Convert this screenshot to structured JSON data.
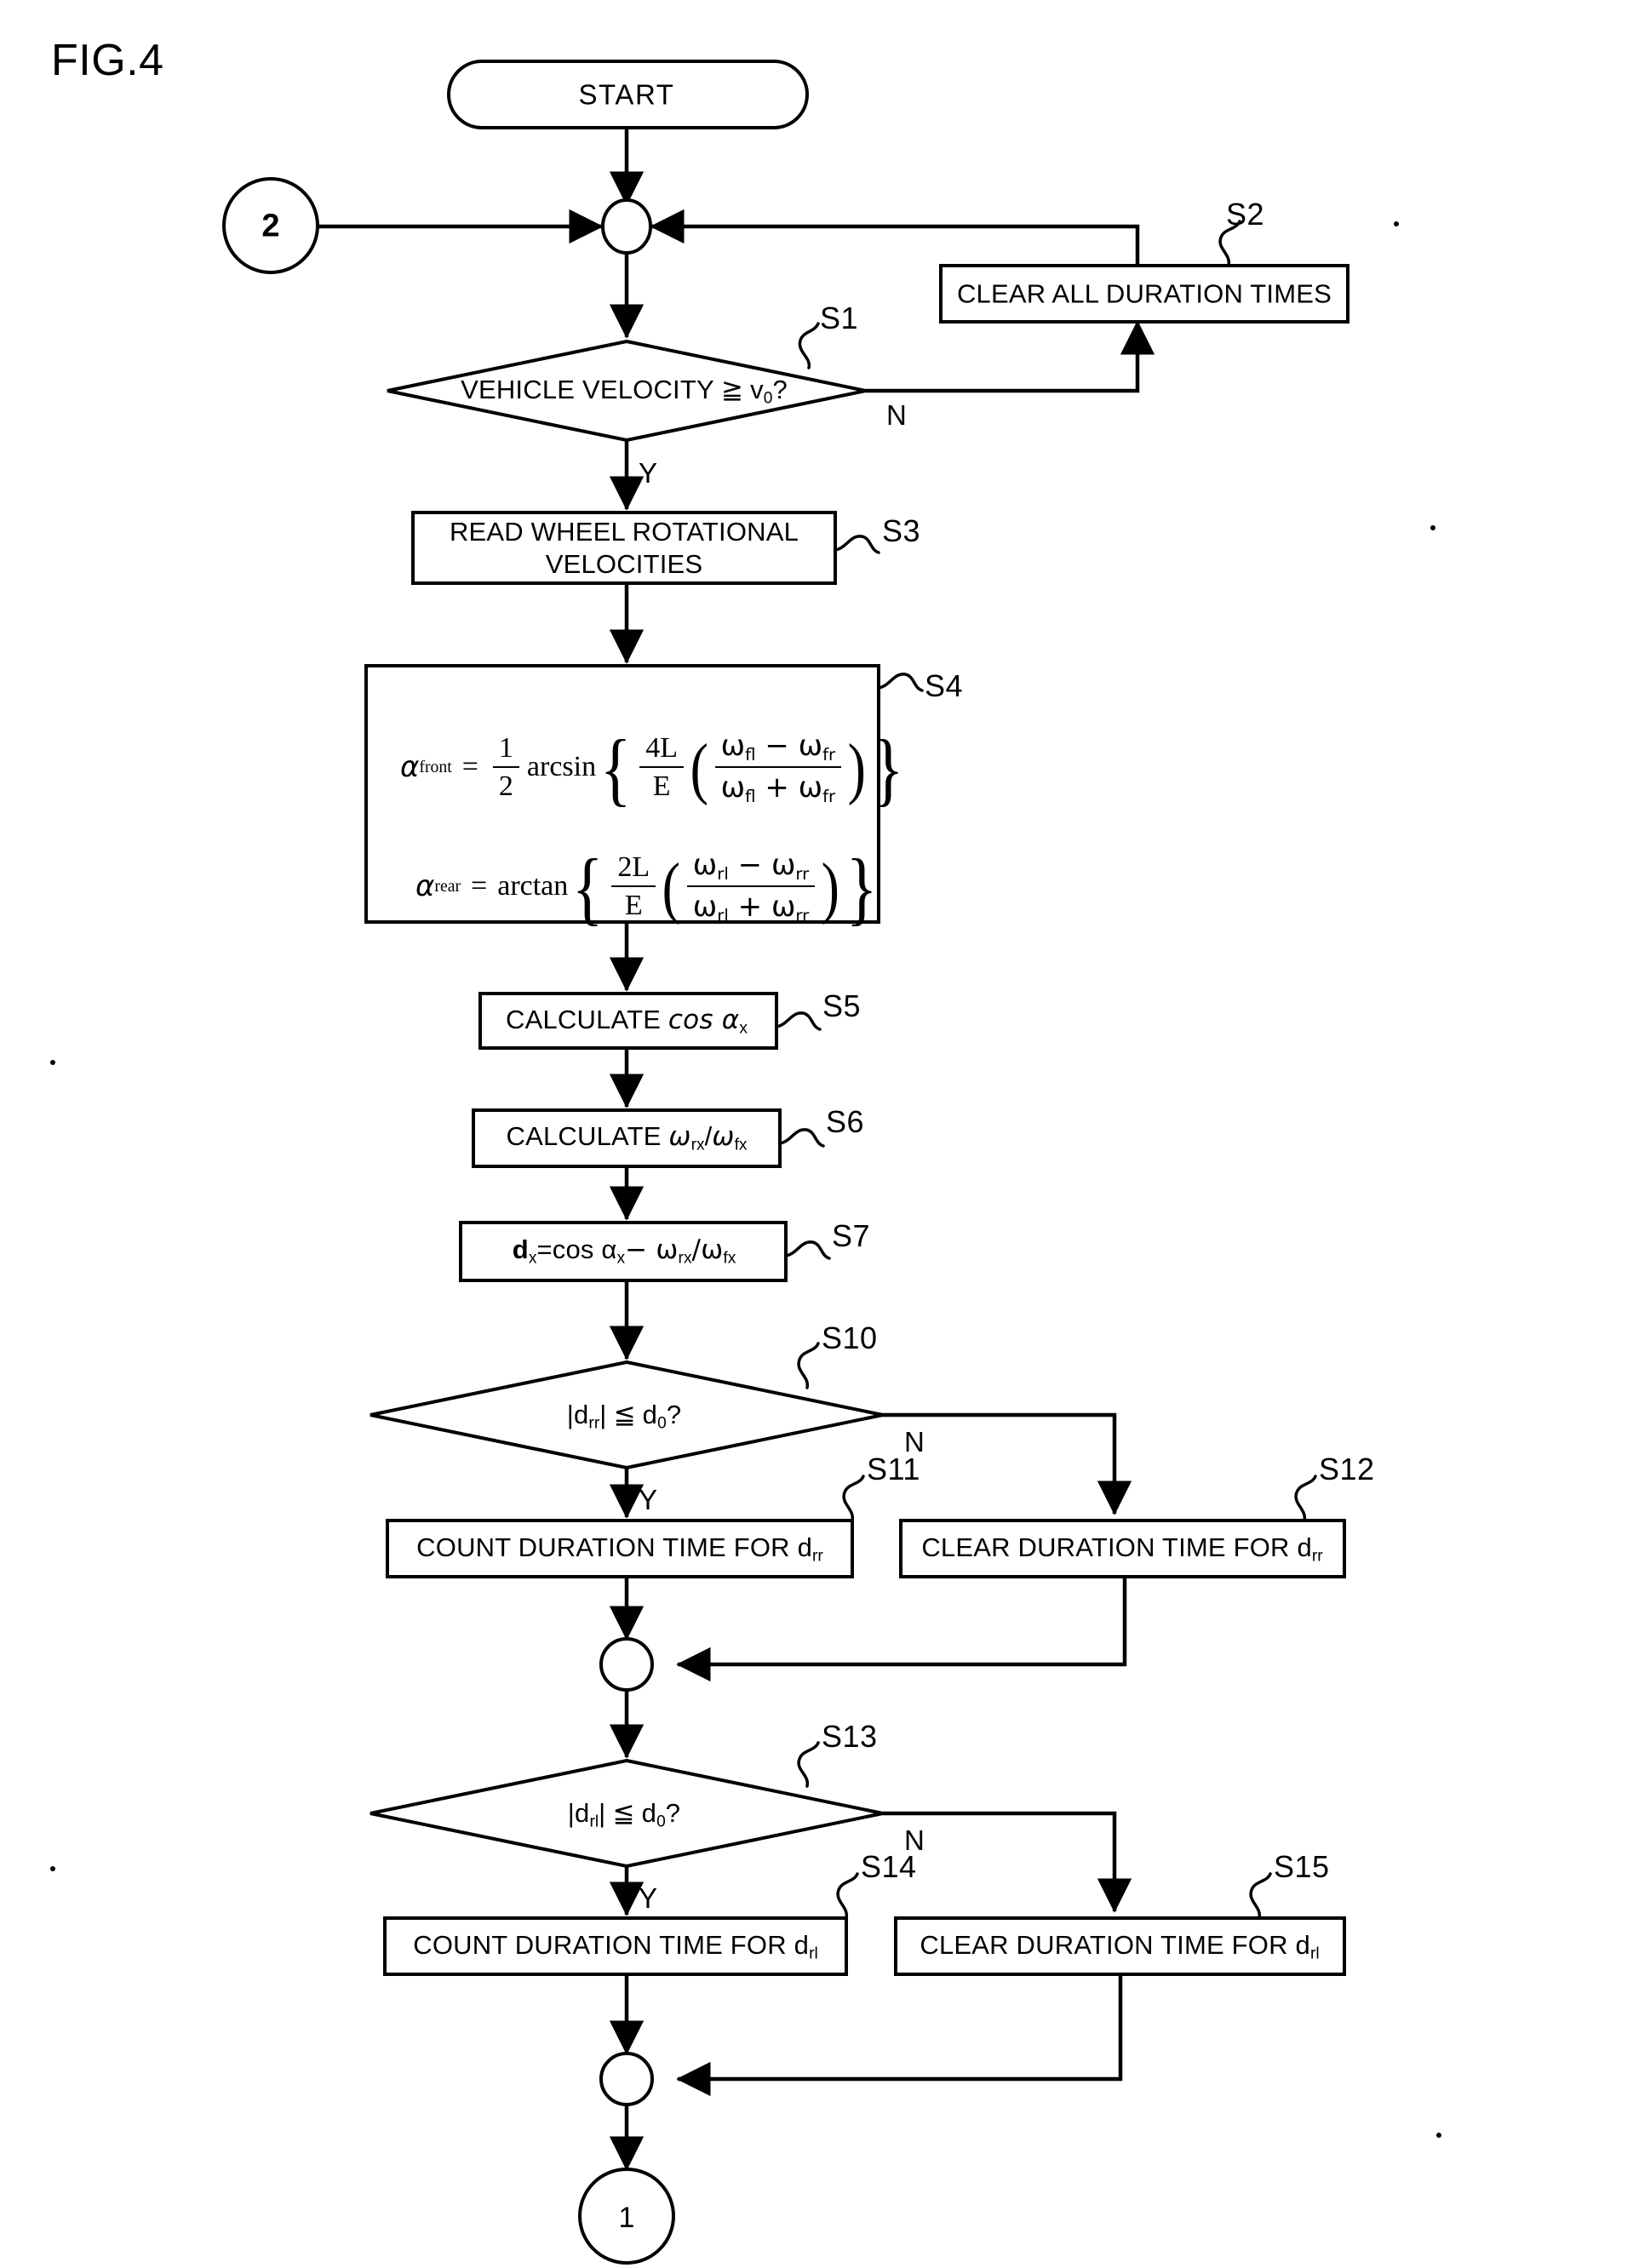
{
  "figure": {
    "title": "FIG.4",
    "type": "patent-flowchart"
  },
  "terminals": {
    "start": {
      "label": "START"
    },
    "connector_in": {
      "label": "2"
    },
    "connector_out": {
      "label": "1"
    }
  },
  "branch_labels": {
    "yes": "Y",
    "no": "N"
  },
  "nodes": [
    {
      "id": "S1",
      "step_id": "S1",
      "kind": "decision",
      "text": "VEHICLE VELOCITY ≧ v0?",
      "text_main": "VEHICLE VELOCITY",
      "text_op": "≧",
      "text_var": "v",
      "text_sub": "0",
      "text_tail": "?"
    },
    {
      "id": "S2",
      "step_id": "S2",
      "kind": "process",
      "text": "CLEAR ALL DURATION TIMES"
    },
    {
      "id": "S3",
      "step_id": "S3",
      "kind": "process",
      "text_line1": "READ WHEEL ROTATIONAL",
      "text_line2": "VELOCITIES"
    },
    {
      "id": "S4",
      "step_id": "S4",
      "kind": "process-formula",
      "formulas": [
        {
          "lhs_var": "α",
          "lhs_sub": "front",
          "op": "=",
          "coef_num": "1",
          "coef_den": "2",
          "fn": "arcsin",
          "outer_num": "4L",
          "outer_den": "E",
          "inner_num": "ω fl − ω fr",
          "inner_den": "ω fl + ω fr"
        },
        {
          "lhs_var": "α",
          "lhs_sub": "rear",
          "op": "=",
          "coef_num": "",
          "coef_den": "",
          "fn": "arctan",
          "outer_num": "2L",
          "outer_den": "E",
          "inner_num": "ω rl − ω rr",
          "inner_den": "ω rl + ω rr"
        }
      ]
    },
    {
      "id": "S5",
      "step_id": "S5",
      "kind": "process",
      "text_prefix": "CALCULATE ",
      "text_expr": "cos α",
      "text_sub": "x"
    },
    {
      "id": "S6",
      "step_id": "S6",
      "kind": "process",
      "text_prefix": "CALCULATE ",
      "text_expr_a": "ω",
      "text_sub_a": "rx",
      "text_slash": "/",
      "text_expr_b": "ω",
      "text_sub_b": "fx"
    },
    {
      "id": "S7",
      "step_id": "S7",
      "kind": "process",
      "text_lhs": "d",
      "text_lhs_sub": "x",
      "text_eq": "=cos α",
      "text_alpha_sub": "x",
      "text_minus": "− ω",
      "text_rx": "rx",
      "text_div": "/ω",
      "text_fx": "fx"
    },
    {
      "id": "S10",
      "step_id": "S10",
      "kind": "decision",
      "text_abs_open": "|d",
      "text_abs_sub": "rr",
      "text_abs_close": "|",
      "text_op": "≦",
      "text_rhs": "d",
      "text_rhs_sub": "0",
      "text_tail": "?"
    },
    {
      "id": "S11",
      "step_id": "S11",
      "kind": "process",
      "text_prefix": "COUNT DURATION TIME FOR d",
      "text_sub": "rr"
    },
    {
      "id": "S12",
      "step_id": "S12",
      "kind": "process",
      "text_prefix": "CLEAR DURATION TIME FOR d",
      "text_sub": "rr"
    },
    {
      "id": "S13",
      "step_id": "S13",
      "kind": "decision",
      "text_abs_open": "|d",
      "text_abs_sub": "rl",
      "text_abs_close": "|",
      "text_op": "≦",
      "text_rhs": "d",
      "text_rhs_sub": "0",
      "text_tail": "?"
    },
    {
      "id": "S14",
      "step_id": "S14",
      "kind": "process",
      "text_prefix": "COUNT DURATION TIME FOR d",
      "text_sub": "rl"
    },
    {
      "id": "S15",
      "step_id": "S15",
      "kind": "process",
      "text_prefix": "CLEAR DURATION TIME FOR d",
      "text_sub": "rl"
    }
  ],
  "style": {
    "ink": "#000000",
    "paper": "#ffffff"
  }
}
